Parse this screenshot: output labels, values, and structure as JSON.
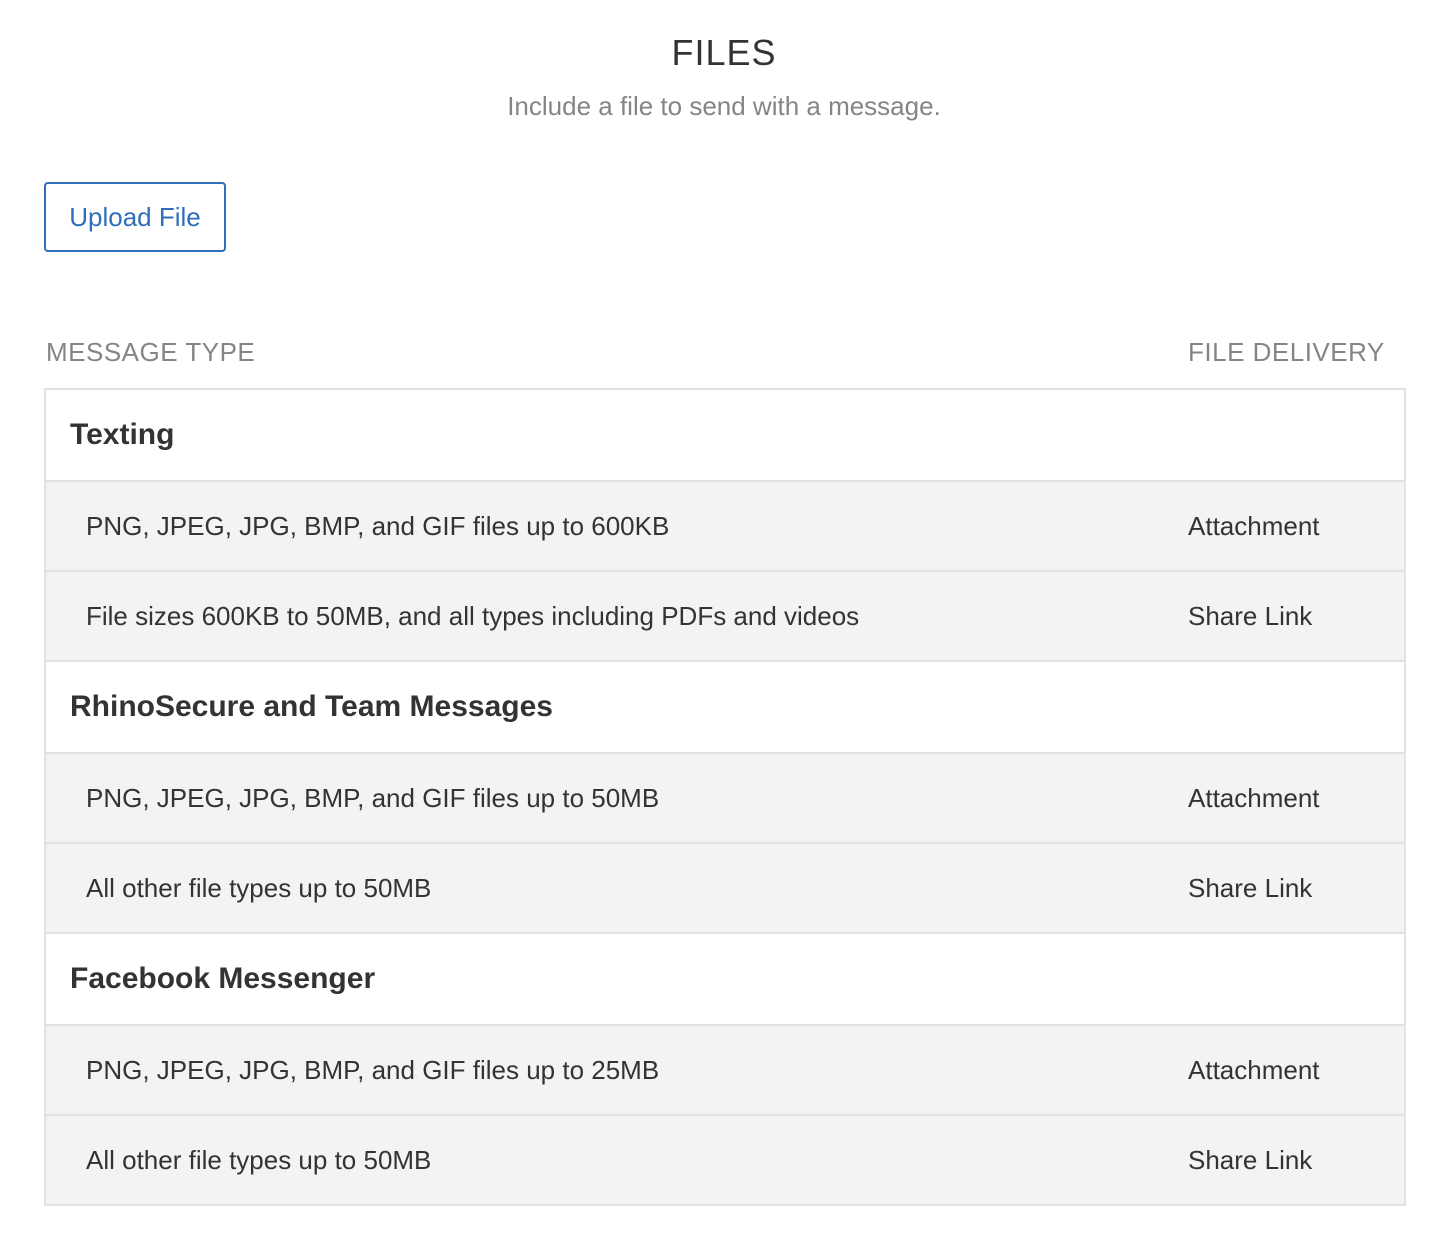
{
  "header": {
    "title": "FILES",
    "subtitle": "Include a file to send with a message."
  },
  "toolbar": {
    "upload_label": "Upload File"
  },
  "table": {
    "columns": {
      "message_type": "MESSAGE TYPE",
      "file_delivery": "FILE DELIVERY"
    },
    "groups": [
      {
        "title": "Texting",
        "rows": [
          {
            "description": "PNG, JPEG, JPG, BMP, and GIF files up to 600KB",
            "delivery": "Attachment"
          },
          {
            "description": "File sizes 600KB to 50MB, and all types including PDFs and videos",
            "delivery": "Share Link"
          }
        ]
      },
      {
        "title": "RhinoSecure and Team Messages",
        "rows": [
          {
            "description": "PNG, JPEG, JPG, BMP, and GIF files up to 50MB",
            "delivery": "Attachment"
          },
          {
            "description": "All other file types up to 50MB",
            "delivery": "Share Link"
          }
        ]
      },
      {
        "title": "Facebook Messenger",
        "rows": [
          {
            "description": "PNG, JPEG, JPG, BMP, and GIF files up to 25MB",
            "delivery": "Attachment"
          },
          {
            "description": "All other file types up to 50MB",
            "delivery": "Share Link"
          }
        ]
      }
    ]
  },
  "colors": {
    "accent": "#2f6fba",
    "muted_text": "#858585",
    "row_background": "#f3f3f3",
    "border": "#e2e2e2"
  }
}
